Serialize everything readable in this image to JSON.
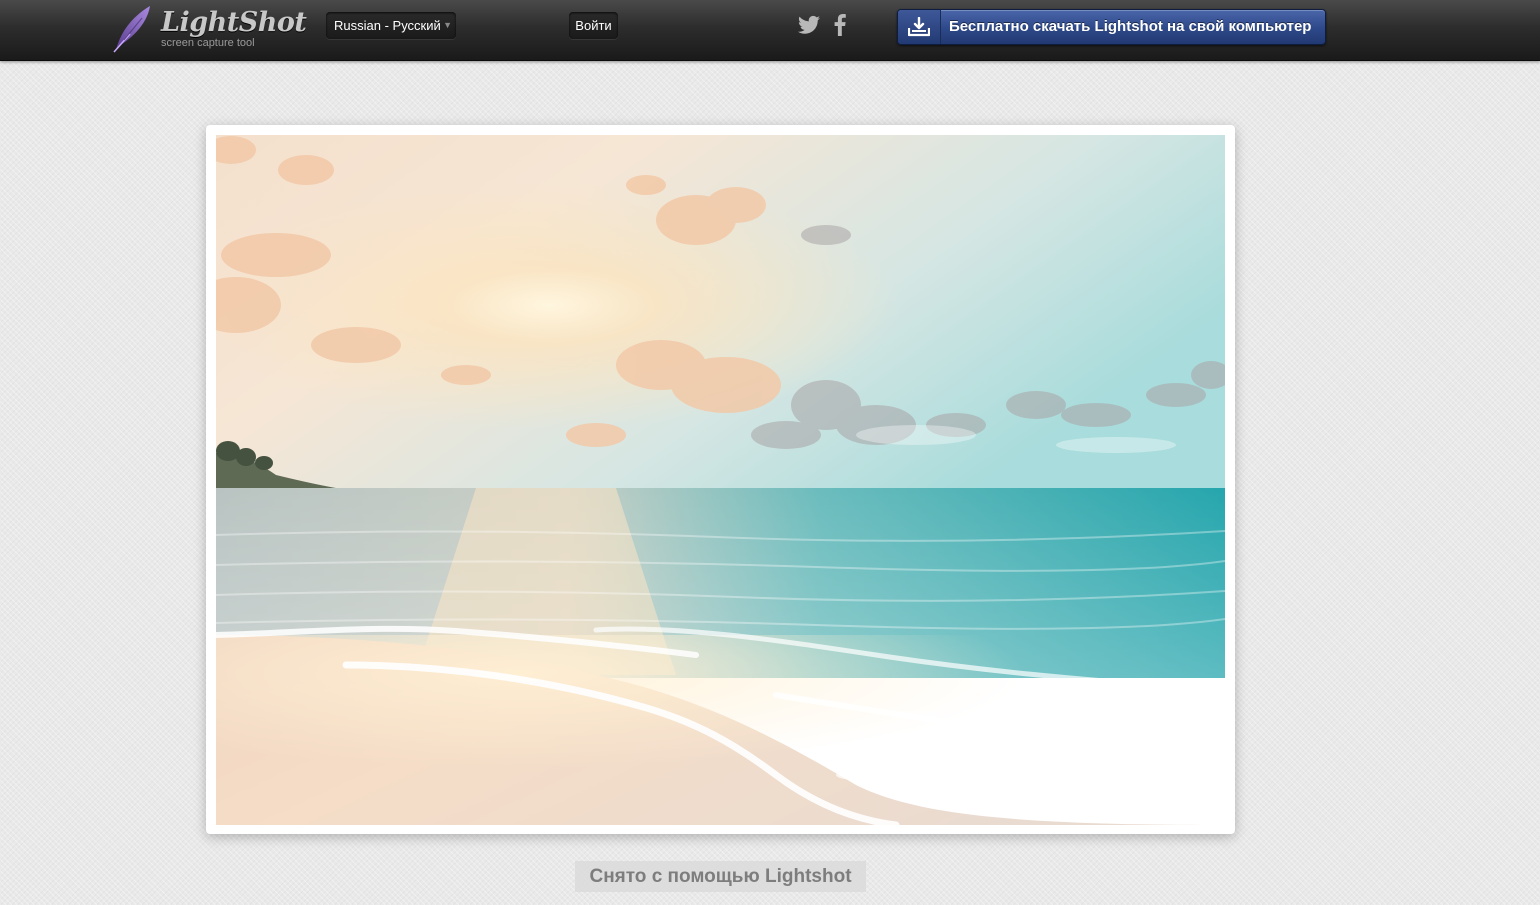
{
  "header": {
    "logo_title": "LightShot",
    "logo_subtitle": "screen capture tool",
    "language": "Russian - Русский",
    "login_label": "Войти",
    "social": [
      "twitter-icon",
      "facebook-icon"
    ],
    "download_label": "Бесплатно скачать Lightshot на свой компьютер"
  },
  "screenshot": {
    "content": "beach-sunset-photo"
  },
  "footer": {
    "caption": "Снято с помощью Lightshot"
  },
  "colors": {
    "header_bg": "#2d2d2d",
    "download_button": "#2f4b8c",
    "page_bg": "#e9e9e9",
    "logo_feather": "#7a58b8"
  }
}
